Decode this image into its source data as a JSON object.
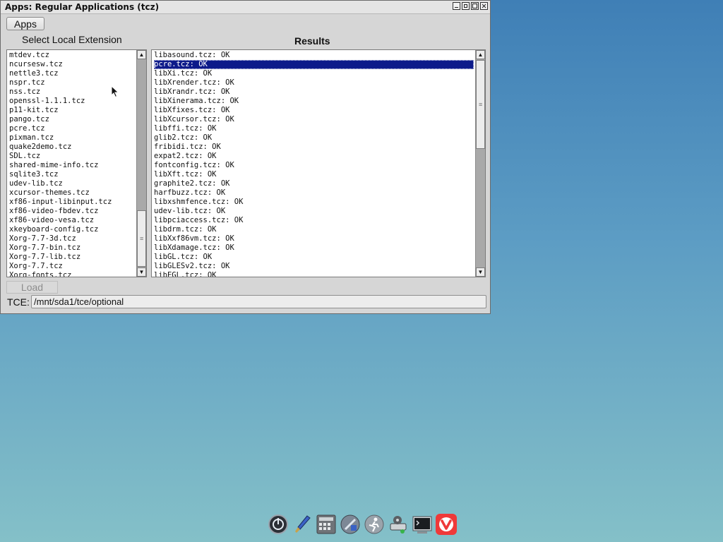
{
  "window": {
    "title": "Apps: Regular Applications (tcz)"
  },
  "toolbar": {
    "apps_label": "Apps"
  },
  "left_panel": {
    "heading": "Select Local Extension",
    "items": [
      "mtdev.tcz",
      "ncursesw.tcz",
      "nettle3.tcz",
      "nspr.tcz",
      "nss.tcz",
      "openssl-1.1.1.tcz",
      "p11-kit.tcz",
      "pango.tcz",
      "pcre.tcz",
      "pixman.tcz",
      "quake2demo.tcz",
      "SDL.tcz",
      "shared-mime-info.tcz",
      "sqlite3.tcz",
      "udev-lib.tcz",
      "xcursor-themes.tcz",
      "xf86-input-libinput.tcz",
      "xf86-video-fbdev.tcz",
      "xf86-video-vesa.tcz",
      "xkeyboard-config.tcz",
      "Xorg-7.7-3d.tcz",
      "Xorg-7.7-bin.tcz",
      "Xorg-7.7-lib.tcz",
      "Xorg-7.7.tcz",
      "Xorg-fonts.tcz"
    ]
  },
  "results_panel": {
    "heading": "Results",
    "selected_index": 1,
    "items": [
      "libasound.tcz: OK",
      "pcre.tcz: OK",
      "libXi.tcz: OK",
      "libXrender.tcz: OK",
      "libXrandr.tcz: OK",
      "libXinerama.tcz: OK",
      "libXfixes.tcz: OK",
      "libXcursor.tcz: OK",
      "libffi.tcz: OK",
      "glib2.tcz: OK",
      "fribidi.tcz: OK",
      "expat2.tcz: OK",
      "fontconfig.tcz: OK",
      "libXft.tcz: OK",
      "graphite2.tcz: OK",
      "harfbuzz.tcz: OK",
      "libxshmfence.tcz: OK",
      "udev-lib.tcz: OK",
      "libpciaccess.tcz: OK",
      "libdrm.tcz: OK",
      "libXxf86vm.tcz: OK",
      "libXdamage.tcz: OK",
      "libGL.tcz: OK",
      "libGLESv2.tcz: OK",
      "libEGL.tcz: OK"
    ]
  },
  "footer": {
    "load_label": "Load",
    "tce_label": "TCE:",
    "tce_path": "/mnt/sda1/tce/optional"
  },
  "dock": {
    "icons": [
      "power-icon",
      "paint-brush-icon",
      "calculator-icon",
      "control-panel-icon",
      "run-icon",
      "mount-tool-icon",
      "terminal-icon",
      "vivaldi-browser-icon"
    ]
  }
}
